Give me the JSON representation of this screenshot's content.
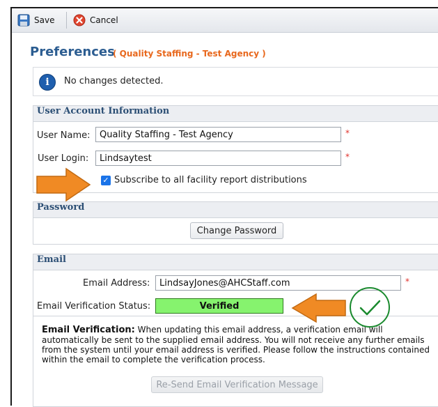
{
  "toolbar": {
    "save_label": "Save",
    "cancel_label": "Cancel"
  },
  "page": {
    "title": "Preferences",
    "subtitle": "( Quality Staffing - Test Agency )"
  },
  "message": {
    "text": "No changes detected."
  },
  "account": {
    "heading": "User Account Information",
    "username_label": "User Name:",
    "username_value": "Quality Staffing - Test Agency",
    "login_label": "User Login:",
    "login_value": "Lindsaytest",
    "subscribe_label": "Subscribe to all facility report distributions",
    "subscribe_checked": true,
    "required_mark": "*"
  },
  "password": {
    "heading": "Password",
    "change_label": "Change Password"
  },
  "email": {
    "heading": "Email",
    "address_label": "Email Address:",
    "address_value": "LindsayJones@AHCStaff.com",
    "status_label": "Email Verification Status:",
    "status_value": "Verified",
    "note_title": "Email Verification:",
    "note_body": "When updating this email address, a verification email will automatically be sent to the supplied email address. You will not receive any further emails from the system until your email address is verified. Please follow the instructions contained within the email to complete the verification process.",
    "resend_label": "Re-Send Email Verification Message"
  },
  "icons": {
    "save": "floppy-disk-icon",
    "cancel": "red-x-circle-icon",
    "info": "info-icon",
    "annotation_arrow": "orange-arrow-icon",
    "annotation_check": "green-check-circle-icon"
  },
  "colors": {
    "title": "#2c5d91",
    "subtitle": "#e8681d",
    "verified_bg": "#86f36e",
    "arrow": "#f08a24",
    "check": "#1a8a2e"
  }
}
